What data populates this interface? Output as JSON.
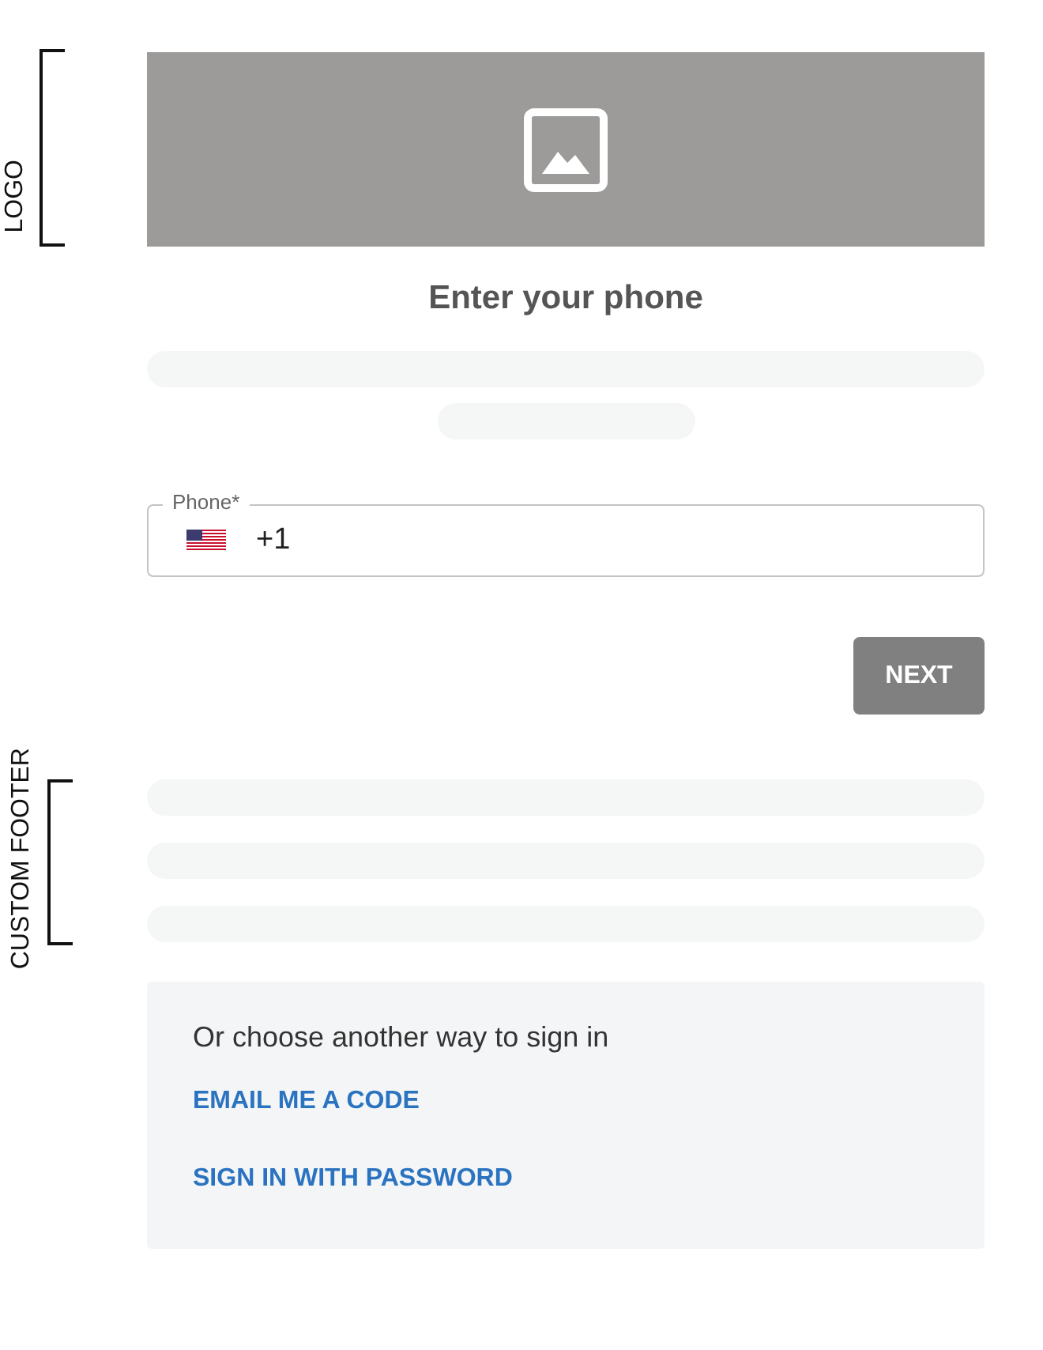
{
  "annotations": {
    "logo": "LOGO",
    "footer": "CUSTOM FOOTER"
  },
  "title": "Enter your phone",
  "phone_field": {
    "label": "Phone*",
    "value": "+1"
  },
  "next_button": "NEXT",
  "alternatives": {
    "heading": "Or choose another way to sign in",
    "links": [
      "EMAIL ME A CODE",
      "SIGN IN WITH PASSWORD"
    ]
  }
}
